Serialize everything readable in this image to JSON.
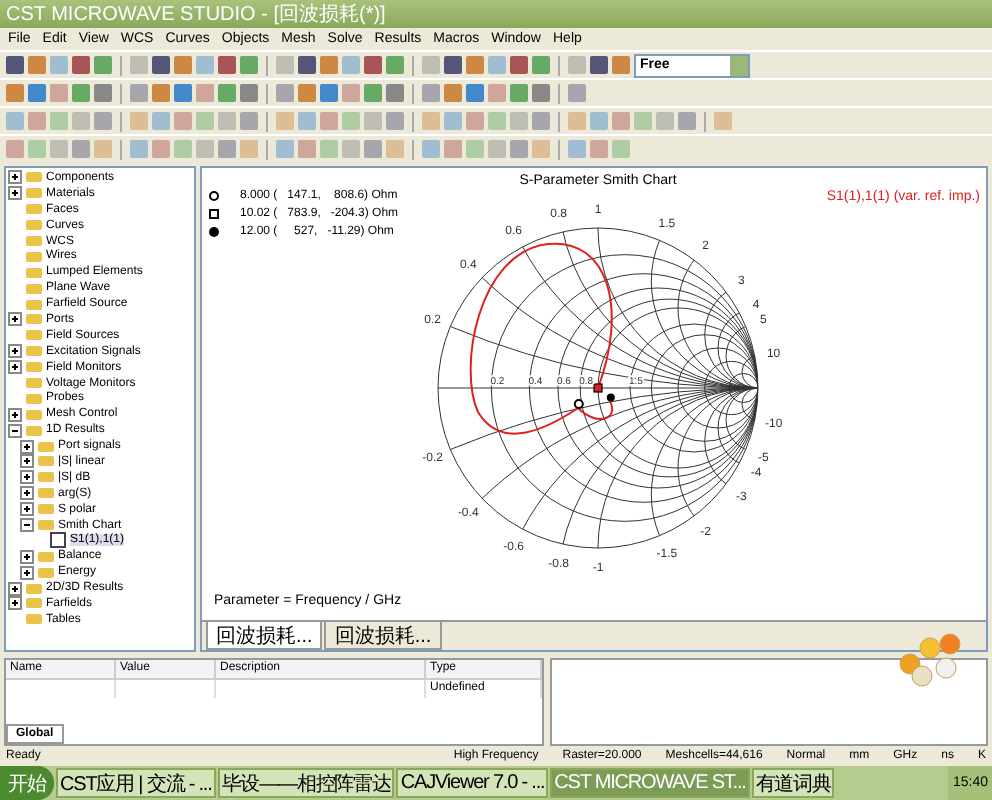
{
  "window": {
    "title": "CST MICROWAVE STUDIO - [回波损耗(*)]"
  },
  "menu": [
    "File",
    "Edit",
    "View",
    "WCS",
    "Curves",
    "Objects",
    "Mesh",
    "Solve",
    "Results",
    "Macros",
    "Window",
    "Help"
  ],
  "toolbar": {
    "view_combo": "Free"
  },
  "tree": [
    {
      "label": "Components",
      "kind": "collapsed",
      "selected": false
    },
    {
      "label": "Materials",
      "kind": "collapsed",
      "selected": false
    },
    {
      "label": "Faces",
      "kind": "plain",
      "selected": false
    },
    {
      "label": "Curves",
      "kind": "plain",
      "selected": false
    },
    {
      "label": "WCS",
      "kind": "plain",
      "selected": false
    },
    {
      "label": "Wires",
      "kind": "plain",
      "selected": false
    },
    {
      "label": "Lumped Elements",
      "kind": "plain",
      "selected": false
    },
    {
      "label": "Plane Wave",
      "kind": "plain",
      "selected": false
    },
    {
      "label": "Farfield Source",
      "kind": "plain",
      "selected": false
    },
    {
      "label": "Ports",
      "kind": "collapsed",
      "selected": false
    },
    {
      "label": "Field Sources",
      "kind": "plain",
      "selected": false
    },
    {
      "label": "Excitation Signals",
      "kind": "collapsed",
      "selected": false
    },
    {
      "label": "Field Monitors",
      "kind": "collapsed",
      "selected": false
    },
    {
      "label": "Voltage Monitors",
      "kind": "plain",
      "selected": false
    },
    {
      "label": "Probes",
      "kind": "plain",
      "selected": false
    },
    {
      "label": "Mesh Control",
      "kind": "collapsed",
      "selected": false
    },
    {
      "label": "1D Results",
      "kind": "expanded",
      "selected": false,
      "children": [
        {
          "label": "Port signals",
          "kind": "collapsed",
          "selected": false
        },
        {
          "label": "|S| linear",
          "kind": "collapsed",
          "selected": false
        },
        {
          "label": "|S| dB",
          "kind": "collapsed",
          "selected": false
        },
        {
          "label": "arg(S)",
          "kind": "collapsed",
          "selected": false
        },
        {
          "label": "S polar",
          "kind": "collapsed",
          "selected": false
        },
        {
          "label": "Smith Chart",
          "kind": "expanded",
          "selected": false,
          "children": [
            {
              "label": "S1(1),1(1)",
              "kind": "curve",
              "selected": true
            }
          ]
        },
        {
          "label": "Balance",
          "kind": "collapsed",
          "selected": false
        },
        {
          "label": "Energy",
          "kind": "collapsed",
          "selected": false
        }
      ]
    },
    {
      "label": "2D/3D Results",
      "kind": "collapsed",
      "selected": false
    },
    {
      "label": "Farfields",
      "kind": "collapsed",
      "selected": false
    },
    {
      "label": "Tables",
      "kind": "plain",
      "selected": false
    }
  ],
  "chart": {
    "title": "S-Parameter Smith Chart",
    "curve_label": "S1(1),1(1) (var. ref. imp.)",
    "markers": [
      {
        "kind": "ring",
        "text": "8.000 (   147.1,    808.6) Ohm"
      },
      {
        "kind": "square",
        "text": "10.02 (   783.9,   -204.3) Ohm"
      },
      {
        "kind": "dot",
        "text": "12.00 (     527,   -11.29) Ohm"
      }
    ],
    "resistance_labels": [
      "0.2",
      "0.4",
      "0.6",
      "0.8",
      "1.5"
    ],
    "reactance_labels": [
      "0.2",
      "0.4",
      "0.6",
      "0.8",
      "1",
      "1.5",
      "2",
      "3",
      "4",
      "5",
      "10",
      "-0.2",
      "-0.4",
      "-0.6",
      "-0.8",
      "-1",
      "-1.5",
      "-2",
      "-3",
      "-4",
      "-5",
      "-10"
    ],
    "parameter_note": "Parameter = Frequency / GHz"
  },
  "doc_tabs": [
    {
      "label": "回波损耗...",
      "selected": true
    },
    {
      "label": "回波损耗...",
      "selected": false
    }
  ],
  "parameters": {
    "columns": [
      "Name",
      "Value",
      "Description",
      "Type"
    ],
    "rows": [
      [
        "",
        "",
        "",
        "Undefined"
      ]
    ],
    "tab": "Global"
  },
  "status_bar": [
    "Ready",
    "High Frequency",
    "Raster=20.000",
    "Meshcells=44,616",
    "Normal",
    "mm",
    "GHz",
    "ns",
    "K"
  ],
  "taskbar": {
    "start": "开始",
    "tasks": [
      {
        "label": "CST应用 | 交流 - ...",
        "selected": false
      },
      {
        "label": "毕设——相控阵雷达",
        "selected": false
      },
      {
        "label": "CAJViewer 7.0 - ...",
        "selected": false
      },
      {
        "label": "CST MICROWAVE ST...",
        "selected": true
      },
      {
        "label": "有道词典",
        "selected": false
      }
    ],
    "clock": "15:40"
  }
}
